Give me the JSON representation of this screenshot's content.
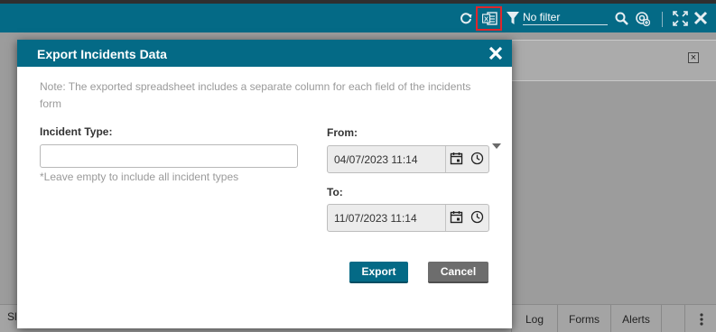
{
  "toolbar": {
    "filter_label": "No filter",
    "icons": [
      "refresh-icon",
      "excel-export-icon",
      "filter-icon",
      "search-icon",
      "target-add-icon",
      "expand-icon",
      "close-icon"
    ],
    "highlight_color": "#e0262b"
  },
  "bottom_tabs": {
    "partial_left": "Sl",
    "items": [
      "Log",
      "Forms",
      "Alerts"
    ]
  },
  "dialog": {
    "title": "Export Incidents Data",
    "note": "Note: The exported spreadsheet includes a separate column for each field of the incidents form",
    "incident_type_label": "Incident Type:",
    "incident_type_value": "",
    "incident_type_hint": "*Leave empty to include all incident types",
    "from_label": "From:",
    "from_value": "04/07/2023 11:14",
    "to_label": "To:",
    "to_value": "11/07/2023 11:14",
    "export_label": "Export",
    "cancel_label": "Cancel"
  },
  "colors": {
    "header": "#046a86",
    "export_button": "#046a86",
    "cancel_button": "#6d6d6d"
  }
}
